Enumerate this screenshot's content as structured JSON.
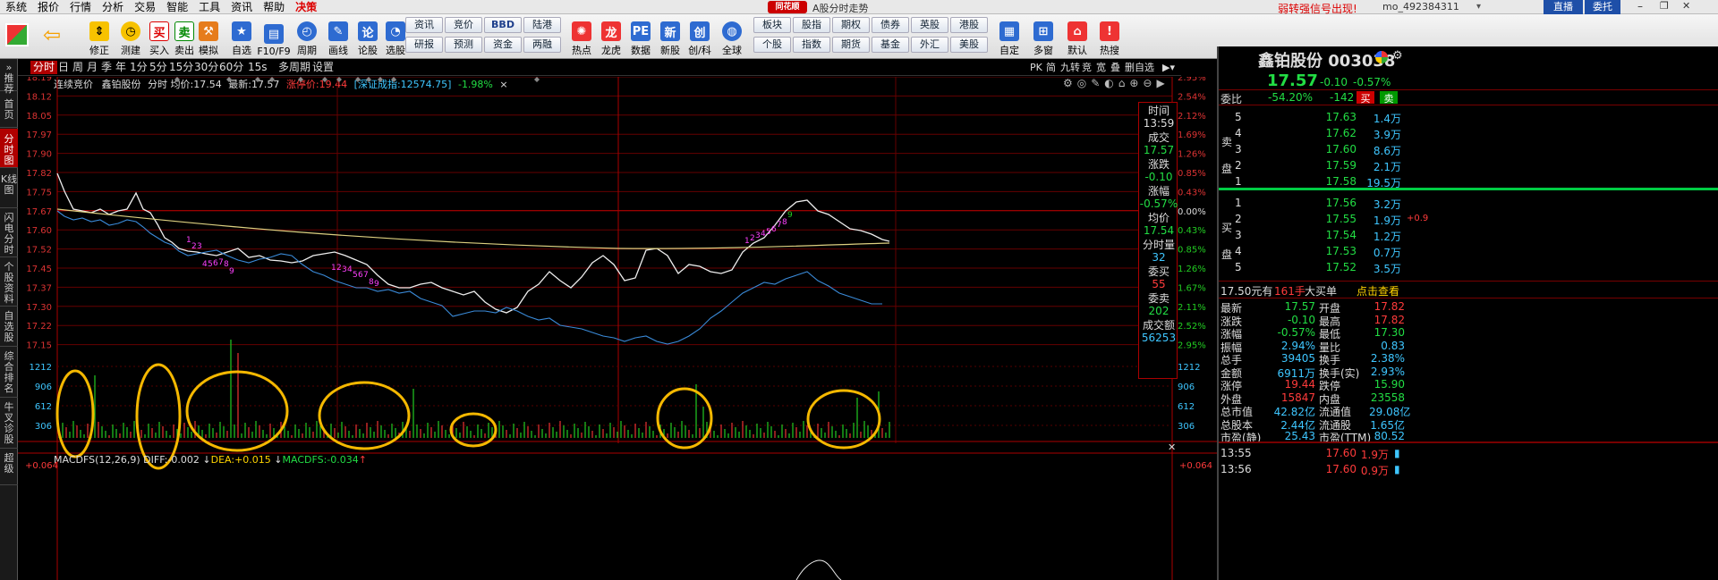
{
  "menu": {
    "items": [
      "系统",
      "报价",
      "行情",
      "分析",
      "交易",
      "智能",
      "工具",
      "资讯",
      "帮助",
      "决策"
    ],
    "center_title": "A股分时走势",
    "notice": "弱转强信号出现!",
    "user": "mo_492384311",
    "btn1": "直播",
    "btn2": "委托"
  },
  "toolbar": {
    "buttons": [
      "修正",
      "测建",
      "买入",
      "卖出",
      "模拟",
      "自选",
      "F10/F9",
      "周期",
      "画线",
      "论股",
      "选股"
    ],
    "pill_top": [
      "资讯",
      "竞价",
      "BBD",
      "陆港"
    ],
    "pill_bot": [
      "研报",
      "预测",
      "资金",
      "两融"
    ],
    "buttons2": [
      "热点",
      "龙虎",
      "数据",
      "新股",
      "创/科",
      "全球"
    ],
    "pill2_top": [
      "板块",
      "股指",
      "期权",
      "债券",
      "英股",
      "港股"
    ],
    "pill2_bot": [
      "个股",
      "指数",
      "期货",
      "基金",
      "外汇",
      "美股"
    ],
    "buttons3": [
      "自定",
      "多窗",
      "默认",
      "热搜"
    ]
  },
  "leftnav": [
    "推荐",
    "首页",
    "分时图",
    "K线图",
    "闪电分时",
    "个股资料",
    "自选股",
    "综合排名",
    "牛叉诊股",
    "超级"
  ],
  "periods": [
    "分时",
    "日",
    "周",
    "月",
    "季",
    "年",
    "1分",
    "5分",
    "15分",
    "30分",
    "60分",
    "15s",
    "多周期",
    "设置"
  ],
  "top_right_tabs": [
    "PK",
    "简",
    "九转",
    "竞",
    "宽",
    "叠",
    "删自选"
  ],
  "info": {
    "prefix": "连续竞价",
    "name": "鑫铂股份",
    "kind": "分时",
    "avg_label": "均价:",
    "avg": "17.54",
    "last_label": "最新:",
    "last": "17.57",
    "limit_label": "涨停价:",
    "limit": "19.44",
    "index_label": "深证成指:",
    "index": "12574.75",
    "index_chg": "-1.98%",
    "close": "×"
  },
  "axis_left": [
    "18.19",
    "18.12",
    "18.05",
    "17.97",
    "17.90",
    "17.82",
    "17.75",
    "17.67",
    "17.60",
    "17.52",
    "17.45",
    "17.37",
    "17.30",
    "17.22",
    "17.15"
  ],
  "axis_right": [
    "2.95%",
    "2.54%",
    "2.12%",
    "1.69%",
    "1.26%",
    "0.85%",
    "0.43%",
    "0.00%",
    "0.43%",
    "0.85%",
    "1.26%",
    "1.67%",
    "2.11%",
    "2.52%",
    "2.95%"
  ],
  "vol_axis": [
    "1212",
    "906",
    "612",
    "306"
  ],
  "macd": {
    "label": "MACDFS(12,26,9)",
    "diff_label": "DIFF:",
    "diff": "-0.002",
    "dea_label": "DEA:",
    "dea": "+0.015",
    "macdfs_label": "MACDFS:",
    "macdfs": "-0.034",
    "axis": [
      "+0.064",
      "+0.064"
    ]
  },
  "cursor_box": {
    "time_label": "时间",
    "time": "13:59",
    "vol_label": "成交",
    "vol": "17.57",
    "chg_label": "涨跌",
    "chg": "-0.10",
    "pct_label": "涨幅",
    "pct": "-0.57%",
    "avg_label": "均价",
    "avg": "17.54",
    "mvol_label": "分时量",
    "mvol": "32",
    "bid_label": "委买",
    "bid": "55",
    "ask_label": "委卖",
    "ask": "202",
    "amt_label": "成交额",
    "amt": "56253"
  },
  "quote": {
    "name": "鑫铂股份",
    "code": "003038",
    "price": "17.57",
    "chg": "-0.10",
    "pct": "-0.57%",
    "wb_label": "委比",
    "wb": "-54.20%",
    "wc": "-142",
    "buy": "买",
    "sell": "卖",
    "sell_side_label": "卖盘",
    "buy_side_label": "买盘",
    "asks": [
      {
        "n": "5",
        "p": "17.63",
        "v": "1.4万"
      },
      {
        "n": "4",
        "p": "17.62",
        "v": "3.9万"
      },
      {
        "n": "3",
        "p": "17.60",
        "v": "8.6万"
      },
      {
        "n": "2",
        "p": "17.59",
        "v": "2.1万"
      },
      {
        "n": "1",
        "p": "17.58",
        "v": "19.5万"
      }
    ],
    "bids": [
      {
        "n": "1",
        "p": "17.56",
        "v": "3.2万",
        "x": ""
      },
      {
        "n": "2",
        "p": "17.55",
        "v": "1.9万",
        "x": "+0.9"
      },
      {
        "n": "3",
        "p": "17.54",
        "v": "1.2万",
        "x": ""
      },
      {
        "n": "4",
        "p": "17.53",
        "v": "0.7万",
        "x": ""
      },
      {
        "n": "5",
        "p": "17.52",
        "v": "3.5万",
        "x": ""
      }
    ],
    "big_price": "17.50元有",
    "big_lots": "161手",
    "big_label": "大买单",
    "big_link": "点击查看",
    "stats": [
      [
        "最新",
        "17.57",
        "开盘",
        "17.82"
      ],
      [
        "涨跌",
        "-0.10",
        "最高",
        "17.82"
      ],
      [
        "涨幅",
        "-0.57%",
        "最低",
        "17.30"
      ],
      [
        "振幅",
        "2.94%",
        "量比",
        "0.83"
      ],
      [
        "总手",
        "39405",
        "换手",
        "2.38%"
      ],
      [
        "金额",
        "6911万",
        "换手(实)",
        "2.93%"
      ],
      [
        "涨停",
        "19.44",
        "跌停",
        "15.90"
      ],
      [
        "外盘",
        "15847",
        "内盘",
        "23558"
      ],
      [
        "总市值",
        "42.82亿",
        "流通值",
        "29.08亿"
      ],
      [
        "总股本",
        "2.44亿",
        "流通股",
        "1.65亿"
      ],
      [
        "市盈(静)",
        "25.43",
        "市盈(TTM)",
        "80.52"
      ]
    ],
    "ticks": [
      [
        "13:55",
        "17.60",
        "1.9万"
      ],
      [
        "13:56",
        "17.60",
        "0.9万"
      ]
    ]
  }
}
